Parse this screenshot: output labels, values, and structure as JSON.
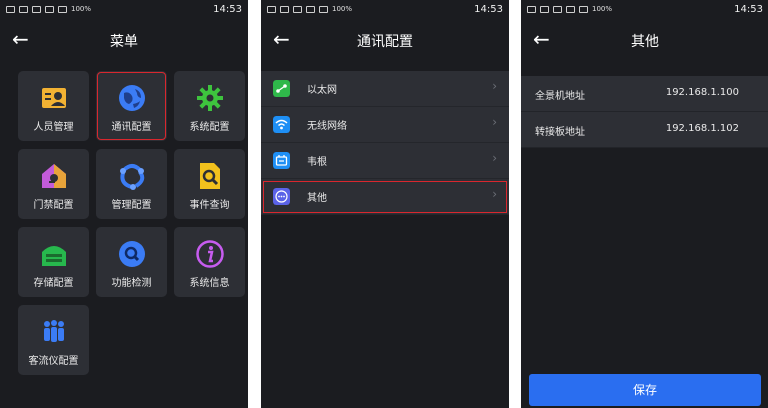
{
  "status": {
    "battery": "100%",
    "time": "14:53"
  },
  "screen1": {
    "title": "菜单",
    "tiles": [
      {
        "label": "人员管理"
      },
      {
        "label": "通讯配置"
      },
      {
        "label": "系统配置"
      },
      {
        "label": "门禁配置"
      },
      {
        "label": "管理配置"
      },
      {
        "label": "事件查询"
      },
      {
        "label": "存储配置"
      },
      {
        "label": "功能检测"
      },
      {
        "label": "系统信息"
      },
      {
        "label": "客流仪配置"
      }
    ]
  },
  "screen2": {
    "title": "通讯配置",
    "items": [
      {
        "label": "以太网"
      },
      {
        "label": "无线网络"
      },
      {
        "label": "韦根"
      },
      {
        "label": "其他"
      }
    ]
  },
  "screen3": {
    "title": "其他",
    "rows": [
      {
        "key": "全景机地址",
        "value": "192.168.1.100"
      },
      {
        "key": "转接板地址",
        "value": "192.168.1.102"
      }
    ],
    "save_label": "保存"
  },
  "colors": {
    "background": "#1b1c20",
    "tile": "#2d2f35",
    "accent": "#2a6ef0",
    "highlight": "#d9272e"
  }
}
